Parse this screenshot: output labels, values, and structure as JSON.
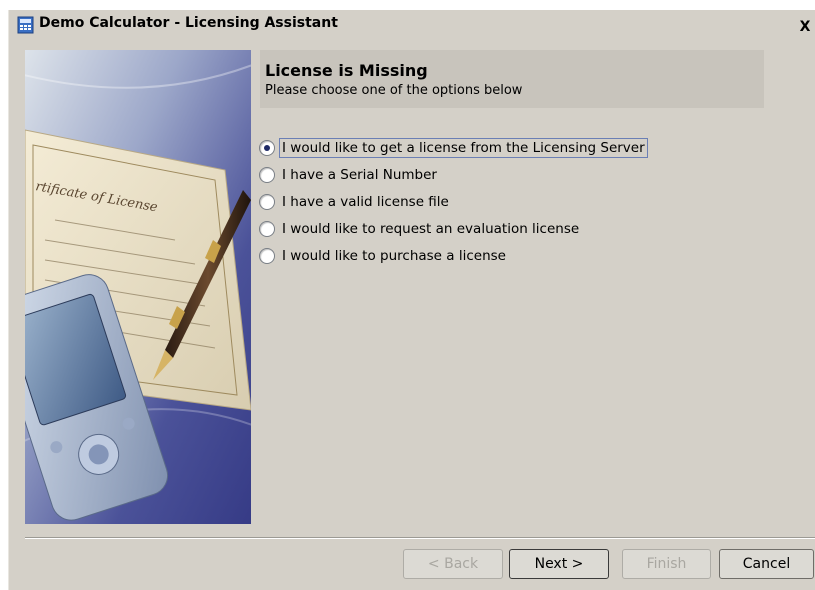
{
  "window": {
    "title": "Demo Calculator - Licensing Assistant",
    "close_glyph": "X",
    "icon": "calculator-app-icon"
  },
  "header": {
    "title": "License is Missing",
    "subtitle": "Please choose one of the options below"
  },
  "options": [
    {
      "label": "I would like to get a license from the Licensing Server",
      "selected": true
    },
    {
      "label": "I have a Serial Number",
      "selected": false
    },
    {
      "label": "I have a valid license file",
      "selected": false
    },
    {
      "label": "I would like to request an evaluation license",
      "selected": false
    },
    {
      "label": "I would like to purchase a license",
      "selected": false
    }
  ],
  "buttons": {
    "back": "< Back",
    "next": "Next >",
    "finish": "Finish",
    "cancel": "Cancel"
  },
  "side_image": {
    "description_icon": "certificate-pen-pda-illustration"
  },
  "colors": {
    "dialog_bg": "#d4d0c8",
    "header_bg": "#c8c4bc",
    "image_bg": "#4a4f97"
  }
}
